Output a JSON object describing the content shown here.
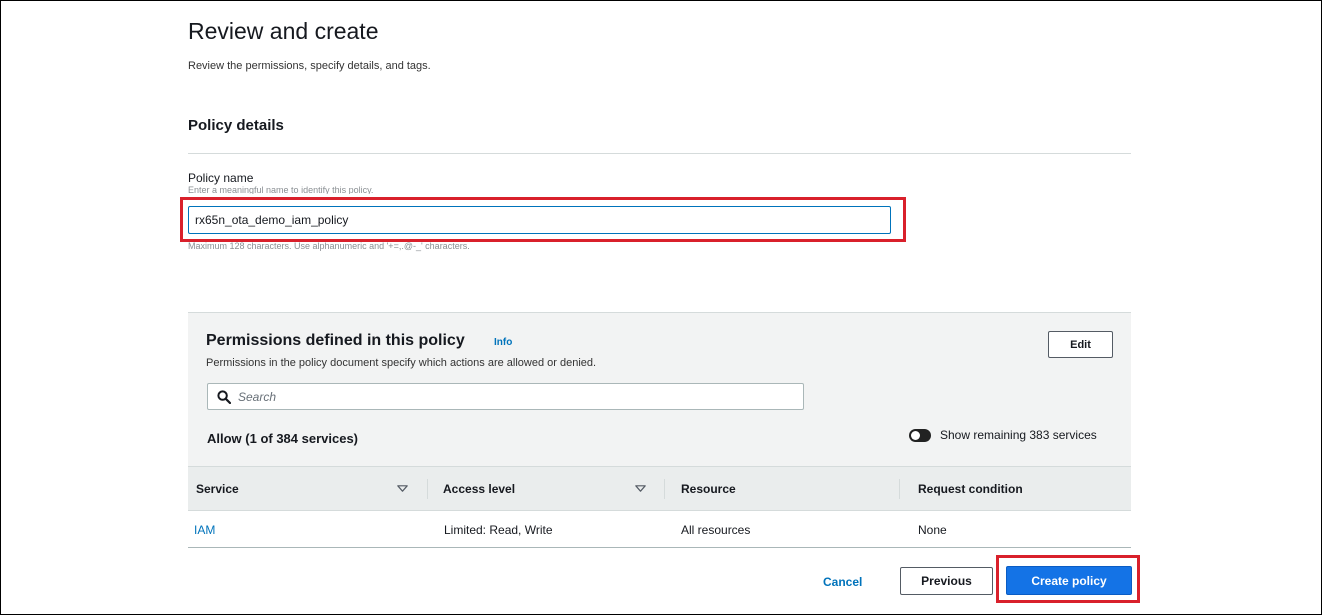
{
  "header": {
    "title": "Review and create",
    "subtitle": "Review the permissions, specify details, and tags."
  },
  "policy_details": {
    "section_title": "Policy details",
    "name_label": "Policy name",
    "name_description": "Enter a meaningful name to identify this policy.",
    "name_value": "rx65n_ota_demo_iam_policy",
    "name_constraint": "Maximum 128 characters. Use alphanumeric and '+=,.@-_' characters."
  },
  "permissions": {
    "title": "Permissions defined in this policy",
    "info_label": "Info",
    "description": "Permissions in the policy document specify which actions are allowed or denied.",
    "edit_label": "Edit",
    "search_placeholder": "Search",
    "allow_heading": "Allow (1 of 384 services)",
    "toggle_label": "Show remaining 383 services",
    "toggle_on": true,
    "columns": [
      "Service",
      "Access level",
      "Resource",
      "Request condition"
    ],
    "rows": [
      {
        "service": "IAM",
        "access_level": "Limited: Read, Write",
        "resource": "All resources",
        "request_condition": "None"
      }
    ]
  },
  "footer": {
    "cancel_label": "Cancel",
    "previous_label": "Previous",
    "create_label": "Create policy"
  },
  "colors": {
    "accent": "#0073bb",
    "primary_button": "#1473e6",
    "highlight": "#d9202b",
    "panel_bg": "#f2f3f3"
  },
  "icons": {
    "search": "search-icon",
    "sort": "caret-down-icon",
    "toggle": "toggle-switch"
  }
}
